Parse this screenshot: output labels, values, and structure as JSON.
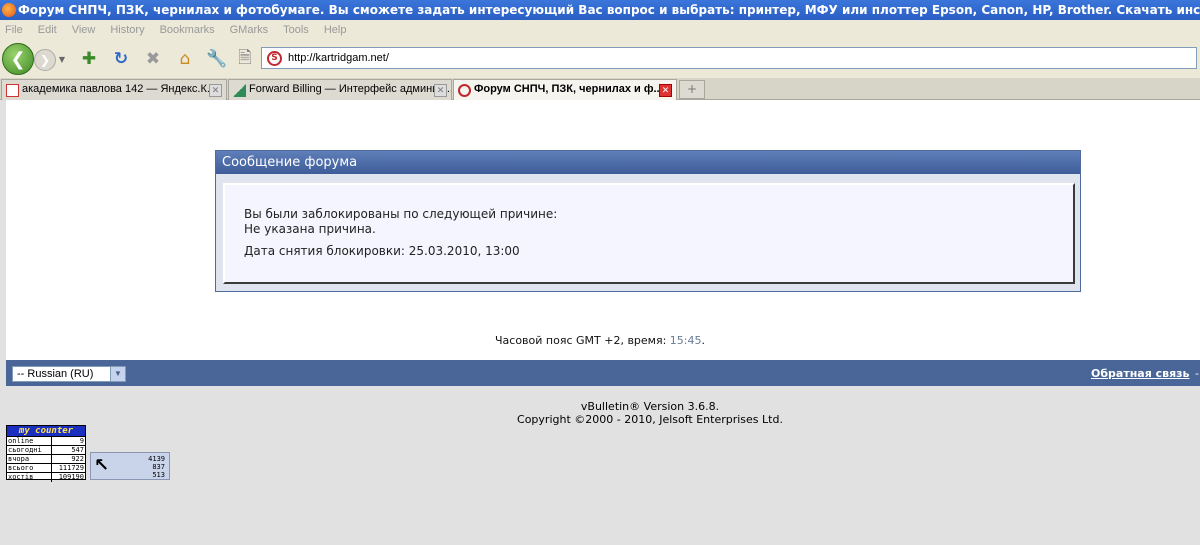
{
  "window": {
    "title": "Форум СНПЧ, ПЗК, чернилах и фотобумаге. Вы сможете задать интересующий Вас вопрос и выбрать: принтер, МФУ или плоттер Epson, Canon, HP, Brother. Скачать инструкцию по установке СНПЧ или"
  },
  "menu": [
    "File",
    "Edit",
    "View",
    "History",
    "Bookmarks",
    "GMarks",
    "Tools",
    "Help"
  ],
  "address_bar": {
    "url": "http://kartridgam.net/"
  },
  "tabs": [
    {
      "label": "академика павлова 142 — Яндекс.К...",
      "active": false
    },
    {
      "label": "Forward Billing — Интерфейс админис...",
      "active": false
    },
    {
      "label": "Форум СНПЧ, ПЗК, чернилах и ф...",
      "active": true
    }
  ],
  "forum_message": {
    "title": "Сообщение форума",
    "line1": "Вы были заблокированы по следующей причине:",
    "line2": "Не указана причина.",
    "line3": "Дата снятия блокировки: 25.03.2010, 13:00"
  },
  "timezone": {
    "text": "Часовой пояс GMT +2, время:",
    "time": "15:45",
    "suffix": "."
  },
  "footer": {
    "language": "-- Russian (RU)",
    "feedback_link": "Обратная связь",
    "dash": "-"
  },
  "copyright": {
    "line1": "vBulletin® Version 3.6.8.",
    "line2": "Copyright ©2000 - 2010, Jelsoft Enterprises Ltd."
  },
  "counter": {
    "title": "my counter",
    "rows": [
      {
        "label": "online",
        "value": "9"
      },
      {
        "label": "сьогодні",
        "value": "547"
      },
      {
        "label": "вчора",
        "value": "922"
      },
      {
        "label": "всього",
        "value": "111729"
      },
      {
        "label": "хостів",
        "value": "109190"
      }
    ]
  },
  "counter2": {
    "values": [
      "4139",
      "837",
      "513"
    ]
  },
  "colors": {
    "accent": "#4a6598",
    "header": "#3d5c99",
    "title_bar": "#2a5ec4"
  }
}
